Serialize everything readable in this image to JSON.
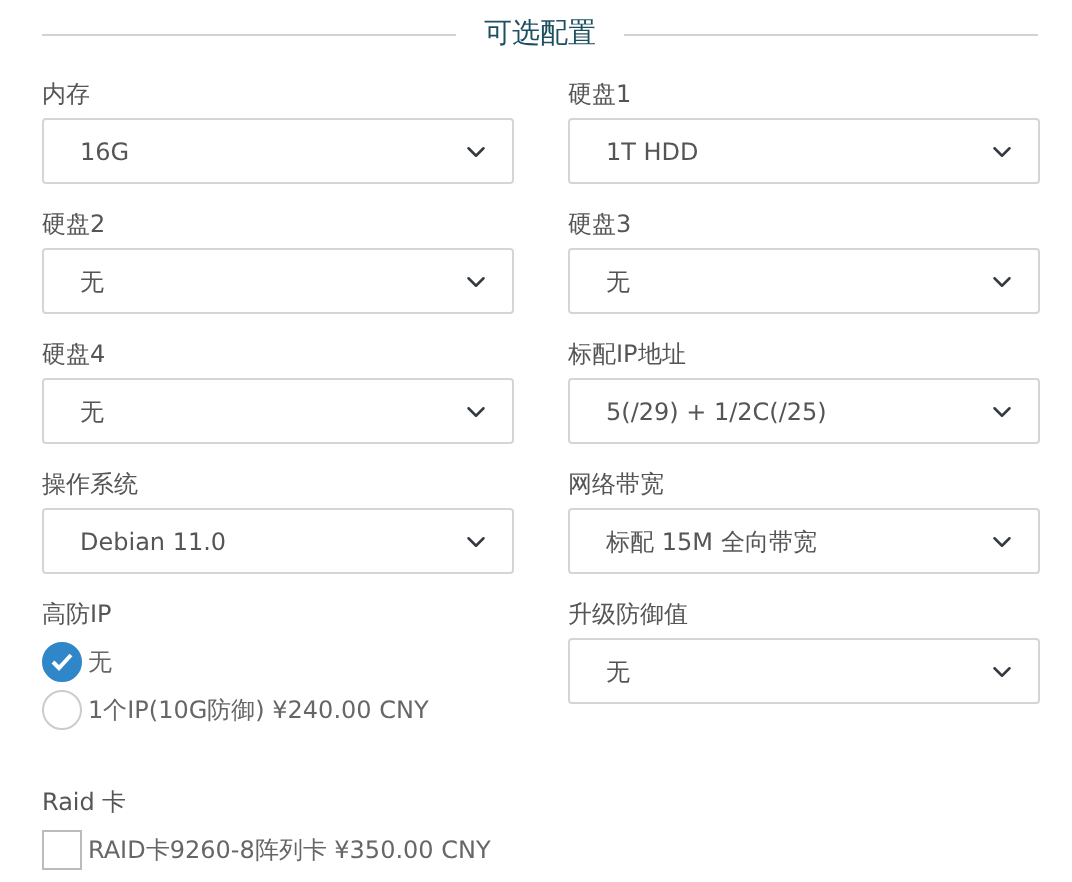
{
  "section_title": "可选配置",
  "fields": [
    {
      "kind": "select",
      "label": "内存",
      "value": "16G"
    },
    {
      "kind": "select",
      "label": "硬盘1",
      "value": "1T HDD"
    },
    {
      "kind": "select",
      "label": "硬盘2",
      "value": "无"
    },
    {
      "kind": "select",
      "label": "硬盘3",
      "value": "无"
    },
    {
      "kind": "select",
      "label": "硬盘4",
      "value": "无"
    },
    {
      "kind": "select",
      "label": "标配IP地址",
      "value": "5(/29) + 1/2C(/25)"
    },
    {
      "kind": "select",
      "label": "操作系统",
      "value": "Debian 11.0"
    },
    {
      "kind": "select",
      "label": "网络带宽",
      "value": "标配 15M 全向带宽"
    },
    {
      "kind": "radio",
      "label": "高防IP",
      "options": [
        {
          "label": "无",
          "selected": true
        },
        {
          "label": "1个IP(10G防御) ¥240.00 CNY",
          "selected": false
        }
      ]
    },
    {
      "kind": "select",
      "label": "升级防御值",
      "value": "无"
    },
    {
      "kind": "checkbox",
      "label": "Raid 卡",
      "options": [
        {
          "label": "RAID卡9260-8阵列卡 ¥350.00 CNY",
          "checked": false
        }
      ]
    }
  ]
}
